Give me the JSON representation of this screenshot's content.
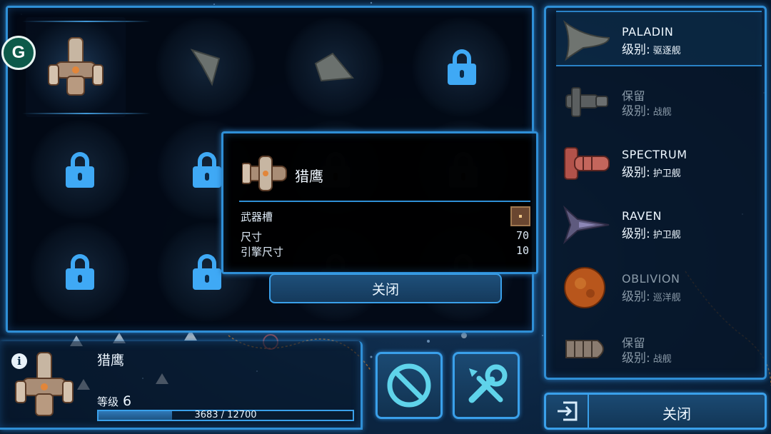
{
  "badge": {
    "letter": "G"
  },
  "popup": {
    "ship_name": "猎鹰",
    "stats": [
      {
        "label": "武器槽",
        "value": ""
      },
      {
        "label": "尺寸",
        "value": "70"
      },
      {
        "label": "引擎尺寸",
        "value": "10"
      }
    ],
    "close_label": "关闭"
  },
  "ships": [
    {
      "name": "PALADIN",
      "class_label": "级别:",
      "class_value": "驱逐舰",
      "available": true,
      "color": "#6f7470"
    },
    {
      "name": "保留",
      "class_label": "级别:",
      "class_value": "战舰",
      "available": false,
      "color": "#5b5f60"
    },
    {
      "name": "SPECTRUM",
      "class_label": "级别:",
      "class_value": "护卫舰",
      "available": true,
      "color": "#b2524a"
    },
    {
      "name": "RAVEN",
      "class_label": "级别:",
      "class_value": "护卫舰",
      "available": true,
      "color": "#5e5a7e"
    },
    {
      "name": "OBLIVION",
      "class_label": "级别:",
      "class_value": "巡洋舰",
      "available": false,
      "color": "#b8561c"
    },
    {
      "name": "保留",
      "class_label": "级别:",
      "class_value": "战舰",
      "available": false,
      "color": "#8a7c70"
    }
  ],
  "current_ship": {
    "name": "猎鹰",
    "level_label": "等级",
    "level": "6",
    "xp_text": "3683 / 12700",
    "xp_fraction": 0.29
  },
  "exit": {
    "label": "关闭"
  },
  "colors": {
    "accent": "#2f8fd6",
    "lock": "#3fa9f5"
  }
}
